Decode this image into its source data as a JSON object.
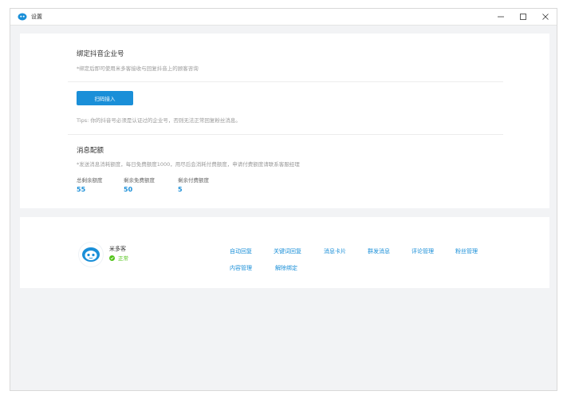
{
  "window": {
    "title": "设置",
    "icon": "app-logo-icon",
    "controls": [
      "minimize-icon",
      "maximize-icon",
      "close-icon"
    ]
  },
  "bind_section": {
    "title": "绑定抖音企业号",
    "subtitle": "*绑定后即可使用米多客接收与回复抖音上的顾客咨询",
    "scan_button": "扫码接入",
    "tips": "Tips:  你的抖音号必须是认证过的企业号，否则无法正常回复粉丝消息。"
  },
  "quota_section": {
    "title": "消息配额",
    "subtitle": "*发送消息消耗额度，每日免费额度1000，用尽后会消耗付费额度，申请付费额度请联系客服经理",
    "items": [
      {
        "label": "总剩余额度",
        "value": "55"
      },
      {
        "label": "剩余免费额度",
        "value": "50"
      },
      {
        "label": "剩余付费额度",
        "value": "5"
      }
    ]
  },
  "account": {
    "name": "米多客",
    "status": "正常",
    "status_color": "#52c41a"
  },
  "menu": [
    "自动回复",
    "关键词回复",
    "消息卡片",
    "群发消息",
    "评论管理",
    "粉丝管理",
    "内容管理",
    "解除绑定"
  ],
  "colors": {
    "accent": "#1a8fd8",
    "background": "#f2f3f5",
    "card": "#ffffff"
  }
}
